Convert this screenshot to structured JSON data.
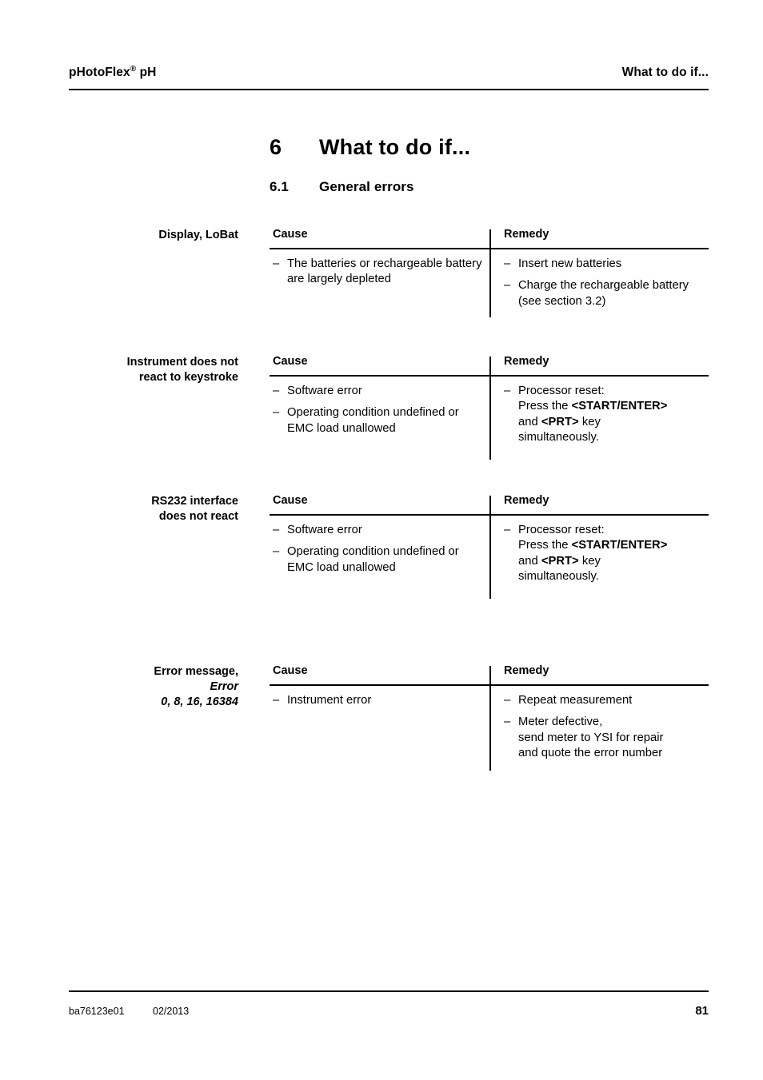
{
  "header": {
    "product": "pHotoFlex",
    "registered_mark": "®",
    "product_suffix": " pH",
    "chapter_ref": "What to do if..."
  },
  "chapter": {
    "number": "6",
    "title": "What to do if..."
  },
  "section": {
    "number": "6.1",
    "title": "General errors"
  },
  "column_headers": {
    "cause": "Cause",
    "remedy": "Remedy"
  },
  "bullet_dash": "–",
  "blocks": [
    {
      "label_line1": "Display, LoBat",
      "label_line2": "",
      "label_line3": "",
      "cause": [
        "The batteries or rechargeable battery are largely depleted"
      ],
      "remedy": [
        "Insert new batteries",
        "Charge the rechargeable battery (see section 3.2)"
      ]
    },
    {
      "label_line1": "Instrument does not",
      "label_line2": "react to keystroke",
      "label_line3": "",
      "cause": [
        "Software error",
        "Operating condition undefined or EMC load unallowed"
      ],
      "remedy_rich": [
        {
          "parts": [
            {
              "text": "Processor reset:",
              "bold": false,
              "break_after": true
            },
            {
              "text": "Press the ",
              "bold": false
            },
            {
              "text": "<START/ENTER>",
              "bold": true,
              "break_after": true
            },
            {
              "text": "and ",
              "bold": false
            },
            {
              "text": "<PRT>",
              "bold": true
            },
            {
              "text": " key",
              "bold": false,
              "break_after": true
            },
            {
              "text": "simultaneously.",
              "bold": false
            }
          ]
        }
      ]
    },
    {
      "label_line1": "RS232 interface",
      "label_line2": "does not react",
      "label_line3": "",
      "cause": [
        "Software error",
        "Operating condition undefined or EMC load unallowed"
      ],
      "remedy_rich": [
        {
          "parts": [
            {
              "text": "Processor reset:",
              "bold": false,
              "break_after": true
            },
            {
              "text": "Press the ",
              "bold": false
            },
            {
              "text": "<START/ENTER>",
              "bold": true,
              "break_after": true
            },
            {
              "text": "and ",
              "bold": false
            },
            {
              "text": "<PRT>",
              "bold": true
            },
            {
              "text": " key",
              "bold": false,
              "break_after": true
            },
            {
              "text": "simultaneously.",
              "bold": false
            }
          ]
        }
      ]
    },
    {
      "label_line1": "Error message,",
      "label_line2": "Error",
      "label_line3": "0, 8, 16, 16384",
      "cause": [
        "Instrument error"
      ],
      "remedy": [
        "Repeat measurement",
        "Meter defective,\nsend meter to YSI for repair\nand quote the error number"
      ]
    }
  ],
  "footer": {
    "doc_id": "ba76123e01",
    "date": "02/2013",
    "page_number": "81"
  }
}
